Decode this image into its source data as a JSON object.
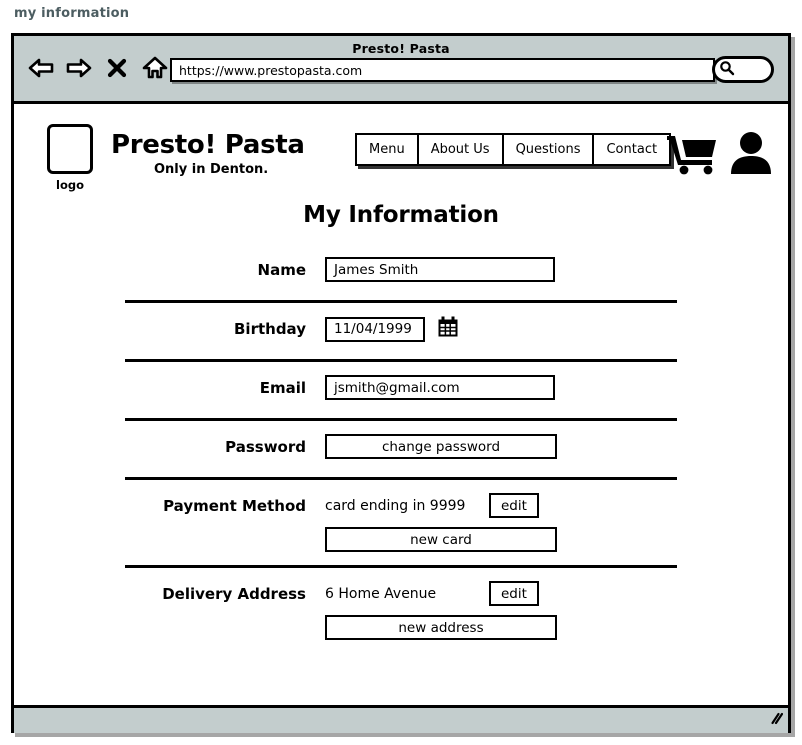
{
  "mockup": {
    "label": "my information"
  },
  "browser": {
    "window_title": "Presto! Pasta",
    "toolbar": {
      "back_icon": "back-arrow-icon",
      "forward_icon": "forward-arrow-icon",
      "stop_icon": "stop-x-icon",
      "home_icon": "home-icon",
      "search_icon": "search-icon"
    },
    "address_bar": {
      "url": "https://www.prestopasta.com",
      "placeholder": "https://www.prestopasta.com"
    },
    "search_box": {
      "value": "",
      "placeholder": ""
    },
    "status_bar": {
      "resize_grip_icon": "resize-grip-icon"
    }
  },
  "site": {
    "logo": {
      "caption": "logo"
    },
    "brand": {
      "name": "Presto! Pasta",
      "tagline": "Only in Denton."
    },
    "nav": [
      {
        "label": "Menu"
      },
      {
        "label": "About Us"
      },
      {
        "label": "Questions"
      },
      {
        "label": "Contact"
      }
    ],
    "actions": {
      "cart_icon": "shopping-cart-icon",
      "account_icon": "user-account-icon"
    }
  },
  "page": {
    "title": "My Information",
    "fields": {
      "name": {
        "label": "Name",
        "value": "James Smith"
      },
      "birthday": {
        "label": "Birthday",
        "value": "11/04/1999",
        "picker_icon": "calendar-icon"
      },
      "email": {
        "label": "Email",
        "value": "jsmith@gmail.com"
      },
      "password": {
        "label": "Password",
        "change_button": "change password"
      },
      "payment_method": {
        "label": "Payment Method",
        "value": "card ending in 9999",
        "edit_button": "edit",
        "new_button": "new card"
      },
      "delivery_address": {
        "label": "Delivery Address",
        "value": "6 Home Avenue",
        "edit_button": "edit",
        "new_button": "new address"
      }
    }
  },
  "colors": {
    "chrome": "#c3cdcd",
    "ink": "#000000",
    "label_text": "#4c5d61",
    "page_background": "#ffffff"
  }
}
